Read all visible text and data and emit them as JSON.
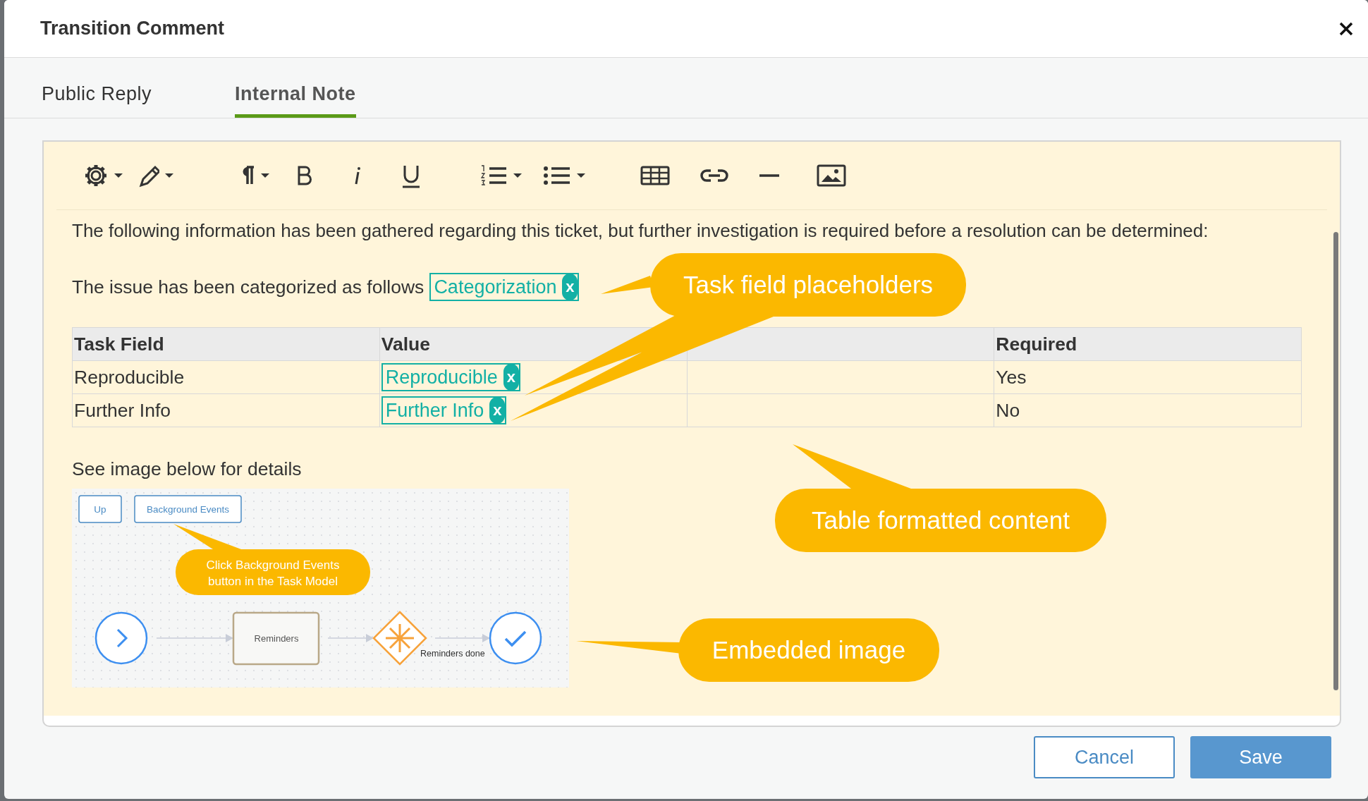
{
  "dialog": {
    "title": "Transition Comment"
  },
  "tabs": [
    {
      "label": "Public Reply",
      "selected": false
    },
    {
      "label": "Internal Note",
      "selected": true
    }
  ],
  "editor": {
    "intro": "The following information has been gathered regarding this ticket, but further investigation is required before a resolution can be determined:",
    "categorization": {
      "text": "The issue has been categorized as follows",
      "token": "Categorization",
      "remove": "x"
    },
    "table": {
      "columns": [
        "Task Field",
        "Value",
        null,
        "Required"
      ],
      "rows": [
        {
          "task_field": "Reproducible",
          "token": "Reproducible",
          "remove": "x",
          "required": "Yes"
        },
        {
          "task_field": "Further Info",
          "token": "Further Info",
          "remove": "x",
          "required": "No"
        }
      ]
    },
    "details": "See image below for details",
    "embedded_image": {
      "buttons": [
        "Up",
        "Background Events"
      ],
      "callout": [
        "Click Background Events",
        "button in the Task Model"
      ],
      "nodes": [
        {
          "kind": "start"
        },
        {
          "kind": "task",
          "label": "Reminders"
        },
        {
          "kind": "event"
        },
        {
          "kind": "end"
        }
      ],
      "edge_label": "Reminders done"
    }
  },
  "annotations": [
    {
      "text": "Task field placeholders"
    },
    {
      "text": "Table formatted content"
    },
    {
      "text": "Embedded image"
    }
  ],
  "buttons": [
    {
      "label": "Cancel",
      "kind": "secondary"
    },
    {
      "label": "Save",
      "kind": "primary"
    }
  ]
}
